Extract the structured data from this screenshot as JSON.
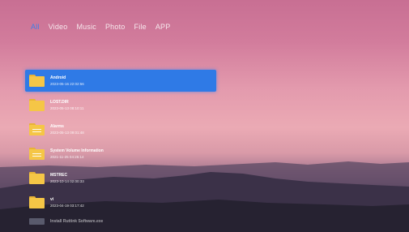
{
  "categories": [
    {
      "label": "All",
      "active": true
    },
    {
      "label": "Video",
      "active": false
    },
    {
      "label": "Music",
      "active": false
    },
    {
      "label": "Photo",
      "active": false
    },
    {
      "label": "File",
      "active": false
    },
    {
      "label": "APP",
      "active": false
    }
  ],
  "files": [
    {
      "name": "Android",
      "date": "2023-05-16 22:02:56",
      "selected": true,
      "lines": false
    },
    {
      "name": "LOST.DIR",
      "date": "2023-05-13 08:10:11",
      "selected": false,
      "lines": false
    },
    {
      "name": "Alarms",
      "date": "2023-05-13 09:01:48",
      "selected": false,
      "lines": true
    },
    {
      "name": "System Volume Information",
      "date": "2021-11-25 04:25:14",
      "selected": false,
      "lines": true
    },
    {
      "name": "MSTREC",
      "date": "2023-10-14 02:00:33",
      "selected": false,
      "lines": false
    },
    {
      "name": "vi",
      "date": "2023-04-19 03:17:42",
      "selected": false,
      "lines": false
    },
    {
      "name": "Install Ruttink Software.exe",
      "date": "",
      "selected": false,
      "lines": false,
      "faded": true
    }
  ],
  "colors": {
    "accent": "#2f7ae6",
    "active_tab": "#3f7fe6",
    "folder": "#f5c646"
  }
}
